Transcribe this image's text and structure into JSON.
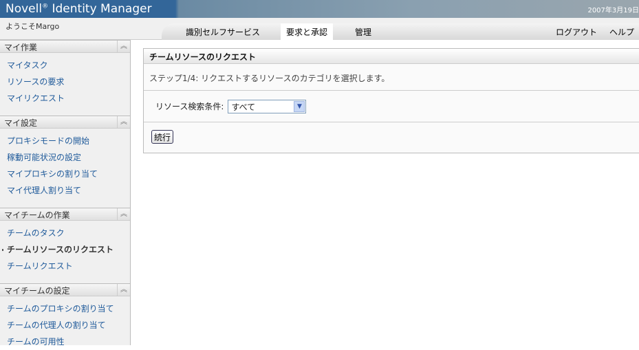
{
  "header": {
    "brand": "Novell",
    "brand_mark": "®",
    "product": "Identity Manager",
    "date": "2007年3月19日",
    "welcome": "ようこそMargo"
  },
  "nav": {
    "tabs": [
      "識別セルフサービス",
      "要求と承認",
      "管理"
    ],
    "active": "要求と承認",
    "logout": "ログアウト",
    "help": "ヘルプ"
  },
  "sidebar": {
    "sections": [
      {
        "title": "マイ作業",
        "items": [
          "マイタスク",
          "リソースの要求",
          "マイリクエスト"
        ]
      },
      {
        "title": "マイ設定",
        "items": [
          "プロキシモードの開始",
          "稼動可能状況の設定",
          "マイプロキシの割り当て",
          "マイ代理人割り当て"
        ]
      },
      {
        "title": "マイチームの作業",
        "items": [
          "チームのタスク",
          "チームリソースのリクエスト",
          "チームリクエスト"
        ]
      },
      {
        "title": "マイチームの設定",
        "items": [
          "チームのプロキシの割り当て",
          "チームの代理人の割り当て",
          "チームの可用性"
        ]
      }
    ],
    "selected": "チームリソースのリクエスト"
  },
  "main": {
    "title": "チームリソースのリクエスト",
    "step_label": "ステップ1/4:",
    "step_text": " リクエストするリソースのカテゴリを選択します。",
    "filter_label": "リソース検索条件:",
    "filter_value": "すべて",
    "continue": "続行"
  }
}
